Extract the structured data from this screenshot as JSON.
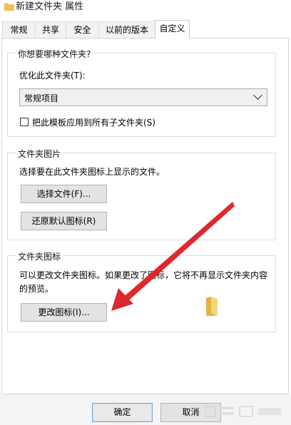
{
  "window": {
    "title": "新建文件夹 属性"
  },
  "tabs": [
    {
      "label": "常规"
    },
    {
      "label": "共享"
    },
    {
      "label": "安全"
    },
    {
      "label": "以前的版本"
    },
    {
      "label": "自定义"
    }
  ],
  "customize": {
    "section1": {
      "title": "你想要哪种文件夹?",
      "optimize_label": "优化此文件夹(T):",
      "optimize_value": "常规项目",
      "apply_subfolders_label": "把此模板应用到所有子文件夹(S)",
      "apply_subfolders_checked": false
    },
    "section2": {
      "title": "文件夹图片",
      "description": "选择要在此文件夹图标上显示的文件。",
      "choose_file_button": "选择文件(F)...",
      "restore_default_button": "还原默认图标(R)"
    },
    "section3": {
      "title": "文件夹图标",
      "description_line1": "可以更改文件夹图标。如果更改了图标，它将不再显示文件夹内容",
      "description_line2": "的预览。",
      "change_icon_button": "更改图标(I)..."
    }
  },
  "footer": {
    "ok_button": "确定",
    "cancel_button": "取消"
  },
  "colors": {
    "arrow": "#e0272d",
    "folder": "#f0c453"
  }
}
